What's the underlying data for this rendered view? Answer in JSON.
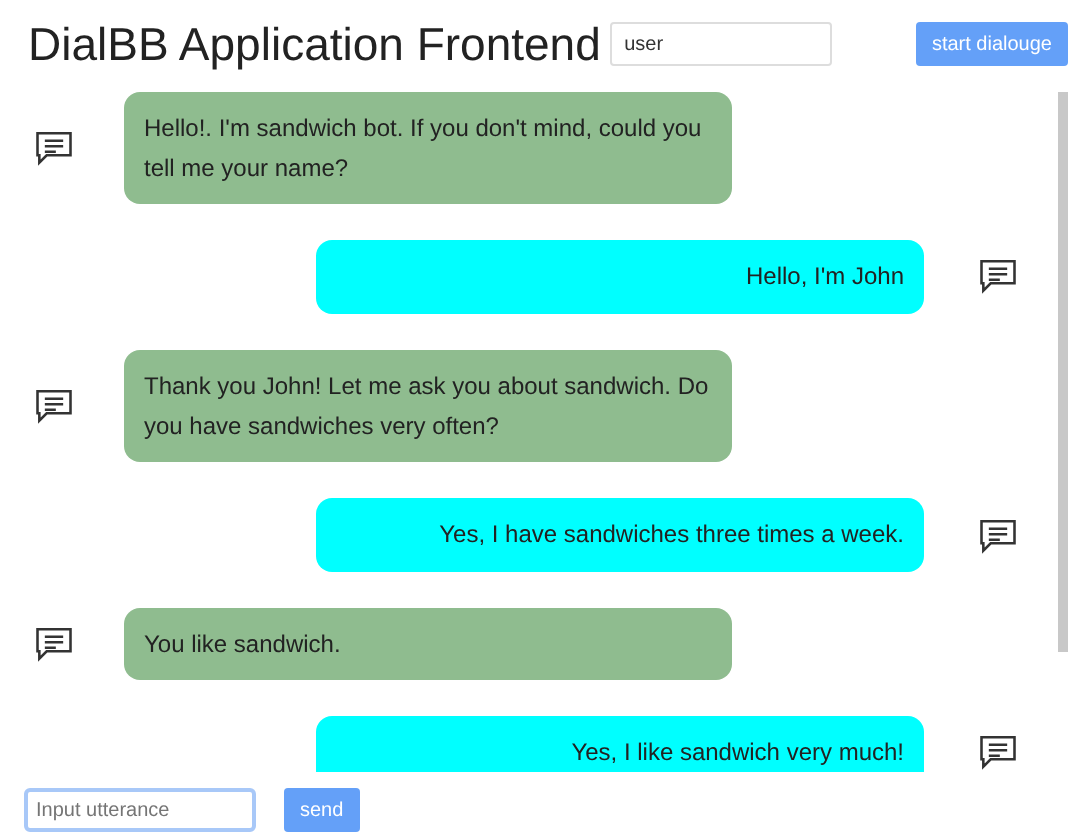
{
  "header": {
    "title": "DialBB Application Frontend",
    "user_field": {
      "value": "user"
    },
    "start_button": "start dialouge"
  },
  "messages": [
    {
      "kind": "bot",
      "text": "Hello!. I'm sandwich bot. If you don't mind, could you tell me your name?"
    },
    {
      "kind": "user",
      "text": "Hello, I'm John"
    },
    {
      "kind": "bot",
      "text": "Thank you John! Let me ask you about sandwich. Do you have sandwiches very often?"
    },
    {
      "kind": "user",
      "text": "Yes, I have sandwiches three times a week."
    },
    {
      "kind": "bot",
      "text": "You like sandwich."
    },
    {
      "kind": "user",
      "text": "Yes, I like sandwich very much!"
    }
  ],
  "composer": {
    "placeholder": "Input utterance",
    "send_button": "send"
  }
}
